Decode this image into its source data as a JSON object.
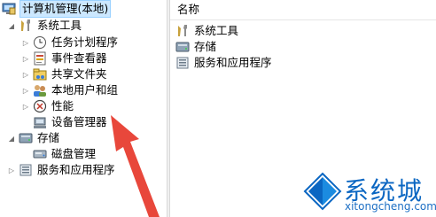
{
  "tree": {
    "root": "计算机管理(本地)",
    "system_tools": "系统工具",
    "task_scheduler": "任务计划程序",
    "event_viewer": "事件查看器",
    "shared_folders": "共享文件夹",
    "local_users": "本地用户和组",
    "performance": "性能",
    "device_manager": "设备管理器",
    "storage": "存储",
    "disk_management": "磁盘管理",
    "services_apps": "服务和应用程序"
  },
  "list": {
    "column_name": "名称",
    "items": [
      "系统工具",
      "存储",
      "服务和应用程序"
    ]
  },
  "watermark": {
    "name": "系统城",
    "url": "xitongcheng.com"
  },
  "colors": {
    "arrow": "#e8473b",
    "brand": "#0a66c2",
    "selection": "#cce8ff"
  }
}
